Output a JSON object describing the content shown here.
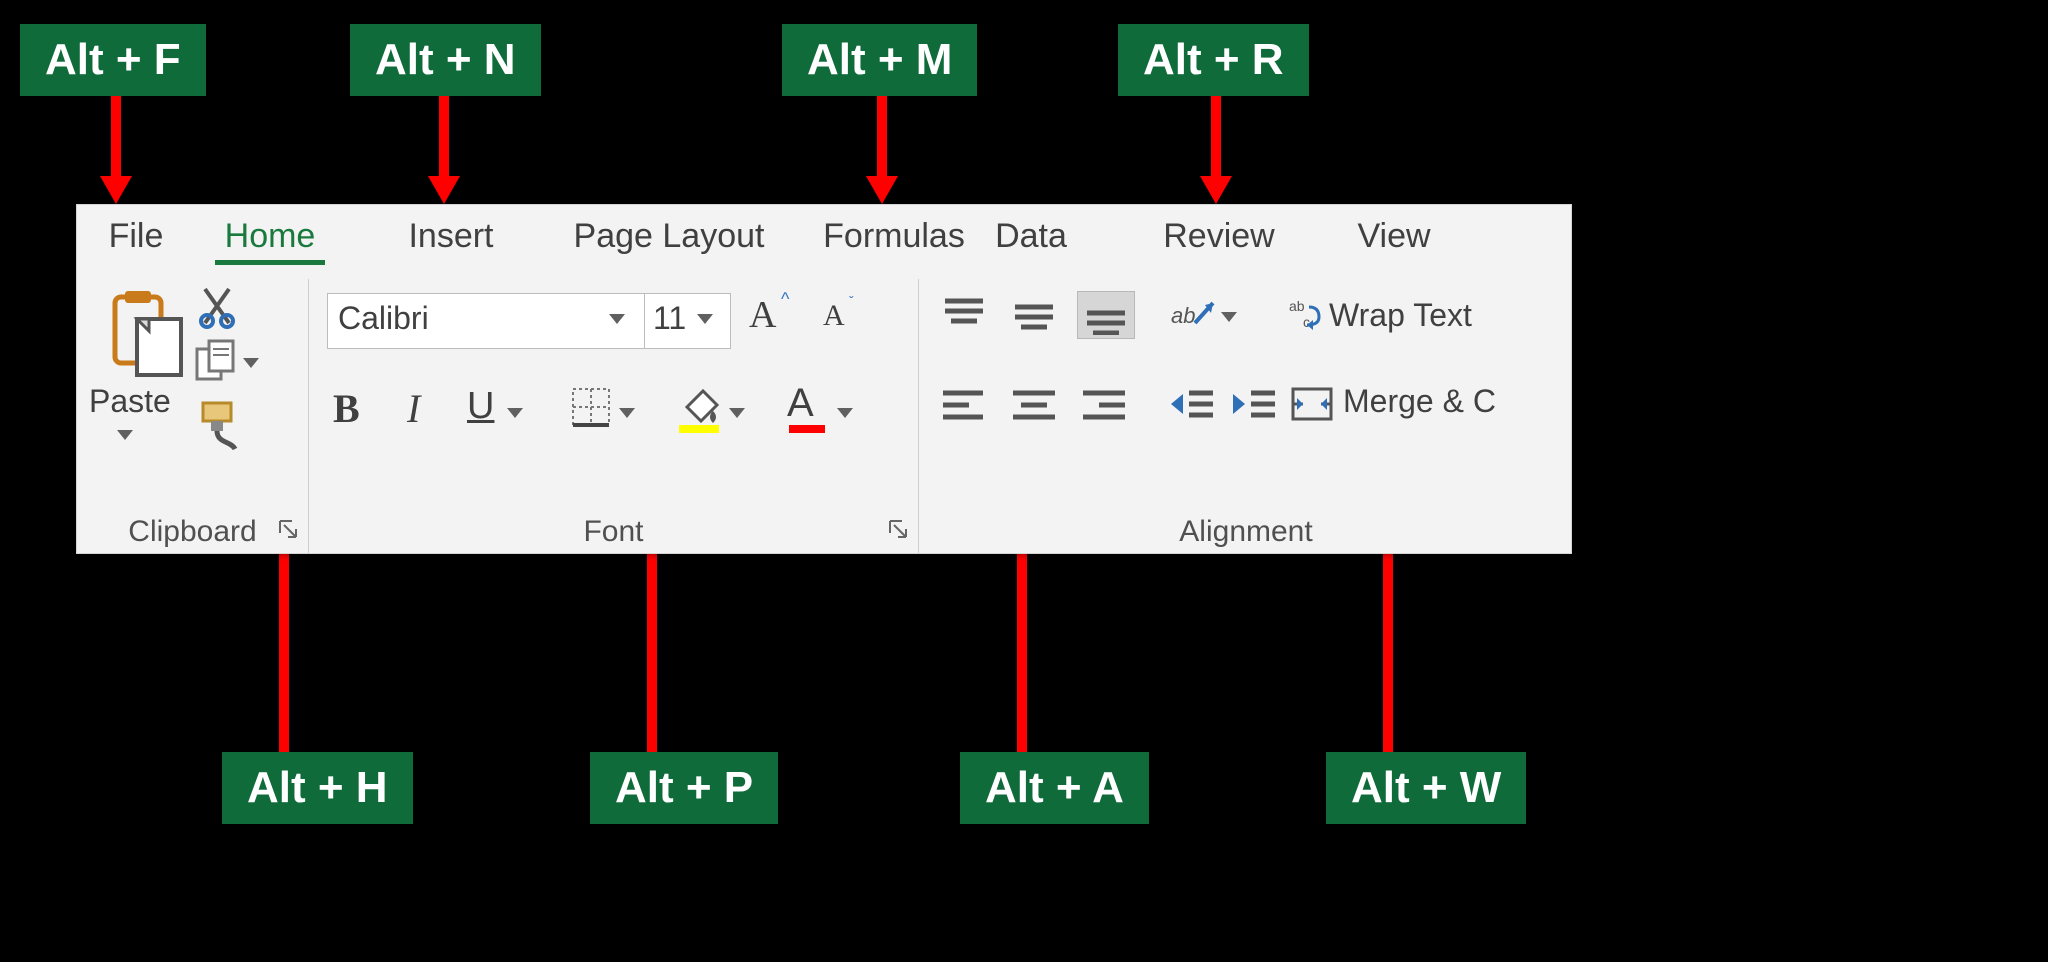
{
  "shortcuts": {
    "file": "Alt + F",
    "home": "Alt + H",
    "insert": "Alt + N",
    "page": "Alt + P",
    "formulas": "Alt + M",
    "data": "Alt + A",
    "review": "Alt + R",
    "view": "Alt + W"
  },
  "tabs": {
    "file": "File",
    "home": "Home",
    "insert": "Insert",
    "page_layout": "Page Layout",
    "formulas": "Formulas",
    "data": "Data",
    "review": "Review",
    "view": "View"
  },
  "clipboard": {
    "paste": "Paste",
    "group": "Clipboard"
  },
  "font": {
    "name": "Calibri",
    "size": "11",
    "bold": "B",
    "italic": "I",
    "underline": "U",
    "grow": "A",
    "shrink": "A",
    "color_letter": "A",
    "group": "Font"
  },
  "alignment": {
    "wrap": "Wrap Text",
    "merge": "Merge & C",
    "group": "Alignment"
  }
}
